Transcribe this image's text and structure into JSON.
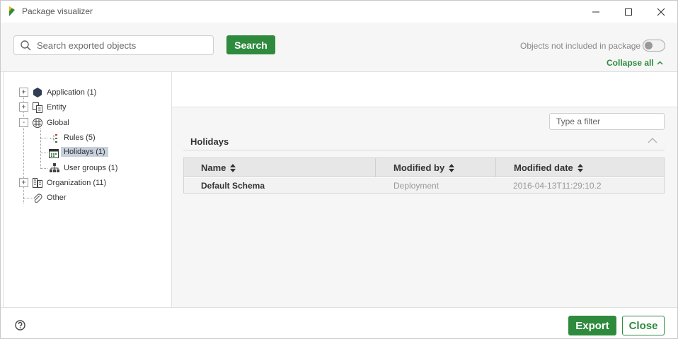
{
  "window": {
    "title": "Package visualizer",
    "accent": "#2e8b3d"
  },
  "header": {
    "search_placeholder": "Search exported objects",
    "search_value": "",
    "search_button": "Search",
    "toggle_label": "Objects not included in package",
    "toggle_on": false,
    "collapse_all": "Collapse all"
  },
  "tree": {
    "items": [
      {
        "label": "Application (1)",
        "icon": "hexagon-icon",
        "expander": "+"
      },
      {
        "label": "Entity",
        "icon": "entity-icon",
        "expander": "+"
      },
      {
        "label": "Global",
        "icon": "globe-icon",
        "expander": "-"
      },
      {
        "label": "Rules (5)",
        "icon": "rules-icon"
      },
      {
        "label": "Holidays (1)",
        "icon": "calendar-icon",
        "selected": true
      },
      {
        "label": "User groups (1)",
        "icon": "user-groups-icon"
      },
      {
        "label": "Organization (11)",
        "icon": "organization-icon",
        "expander": "+"
      },
      {
        "label": "Other",
        "icon": "paperclip-icon"
      }
    ]
  },
  "main": {
    "filter_placeholder": "Type a filter",
    "section_title": "Holidays",
    "columns": [
      "Name",
      "Modified by",
      "Modified date"
    ],
    "rows": [
      [
        "Default Schema",
        "Deployment",
        "2016-04-13T11:29:10.2"
      ]
    ]
  },
  "footer": {
    "export_label": "Export",
    "close_label": "Close"
  }
}
